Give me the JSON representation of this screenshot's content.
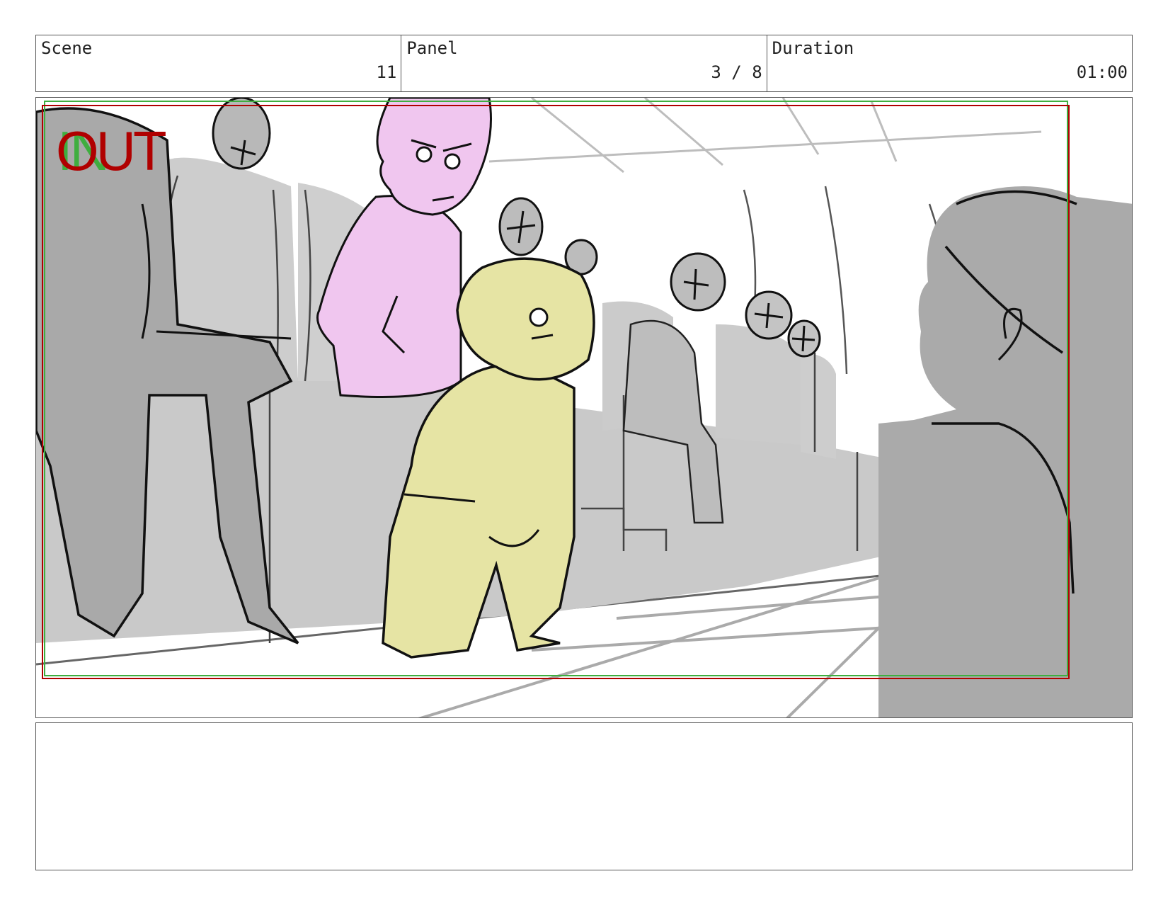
{
  "header": {
    "scene": {
      "label": "Scene",
      "value": "11"
    },
    "panel": {
      "label": "Panel",
      "value": "3 / 8"
    },
    "duration": {
      "label": "Duration",
      "value": "01:00"
    }
  },
  "frame": {
    "in_marker": "IN",
    "out_marker": "OUT",
    "colors": {
      "in": "#3fae3f",
      "out": "#b00000",
      "pink_character": "#f0c6ef",
      "yellow_character": "#e6e4a4",
      "seats": "#c8c8c8",
      "dark_figures": "#a8a8a8"
    }
  },
  "notes": {
    "text": ""
  }
}
